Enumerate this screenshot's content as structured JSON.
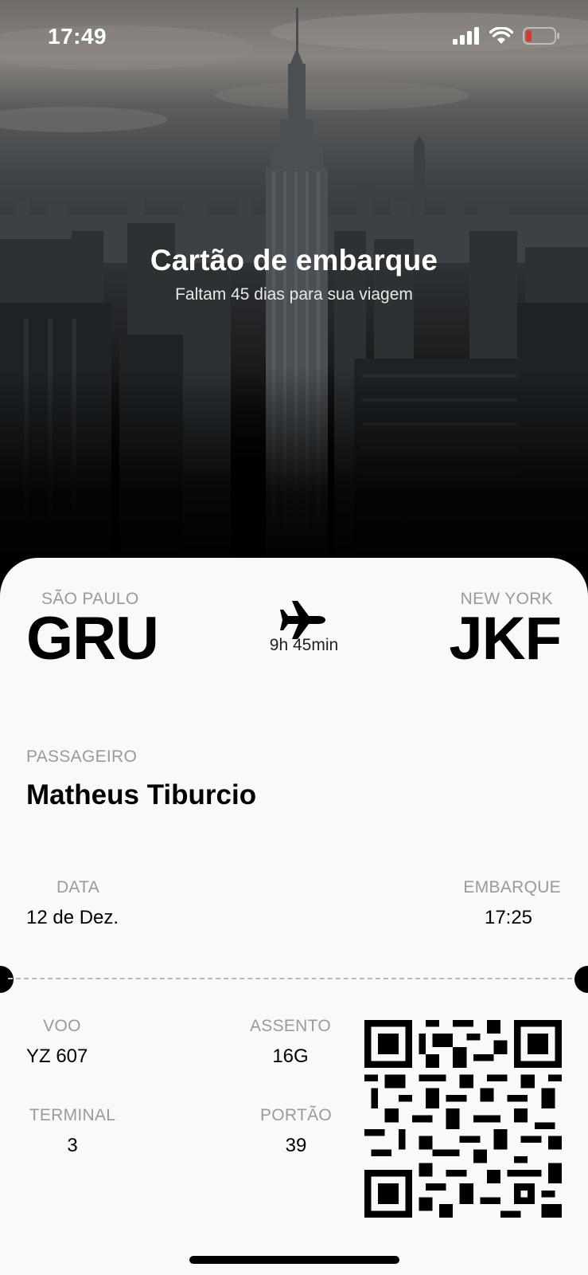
{
  "status_bar": {
    "time": "17:49",
    "icons": [
      "cellular-signal-icon",
      "wifi-icon",
      "battery-low-icon"
    ],
    "battery_color": "#e5332a"
  },
  "hero": {
    "title": "Cartão de embarque",
    "subtitle": "Faltam 45 dias para sua viagem"
  },
  "boarding_pass": {
    "origin": {
      "city": "SÃO PAULO",
      "code": "GRU"
    },
    "destination": {
      "city": "NEW YORK",
      "code": "JKF"
    },
    "flight_icon": "airplane-icon",
    "duration": "9h 45min",
    "passenger": {
      "label": "PASSAGEIRO",
      "name": "Matheus Tiburcio"
    },
    "date": {
      "label": "DATA",
      "value": "12 de Dez."
    },
    "boarding": {
      "label": "EMBARQUE",
      "value": "17:25"
    },
    "flight": {
      "label": "VOO",
      "value": "YZ 607"
    },
    "seat": {
      "label": "ASSENTO",
      "value": "16G"
    },
    "terminal": {
      "label": "TERMINAL",
      "value": "3"
    },
    "gate": {
      "label": "PORTÃO",
      "value": "39"
    },
    "qr_icon": "qr-code-icon"
  }
}
